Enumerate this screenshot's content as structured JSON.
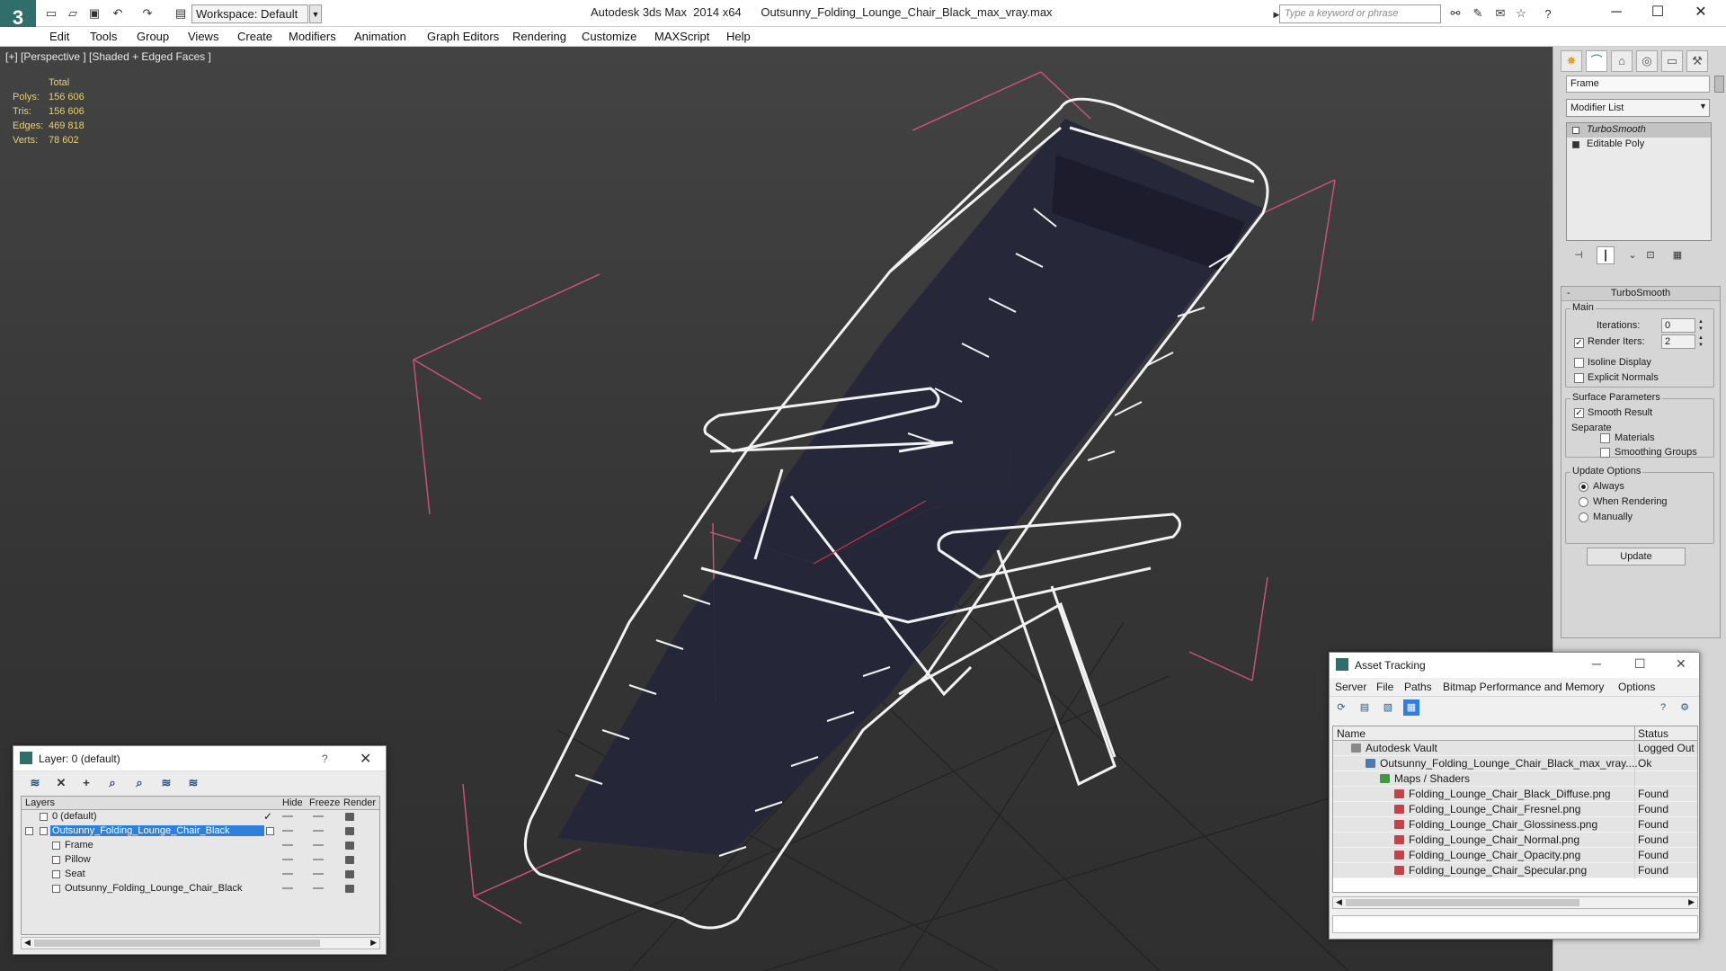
{
  "titlebar": {
    "workspace": "Workspace: Default",
    "title": "Autodesk 3ds Max  2014 x64      Outsunny_Folding_Lounge_Chair_Black_max_vray.max",
    "search_placeholder": "Type a keyword or phrase"
  },
  "menu": [
    "Edit",
    "Tools",
    "Group",
    "Views",
    "Create",
    "Modifiers",
    "Animation",
    "Graph Editors",
    "Rendering",
    "Customize",
    "MAXScript",
    "Help"
  ],
  "viewport": {
    "label": "[+] [Perspective ] [Shaded + Edged Faces ]",
    "stats": {
      "header": "Total",
      "rows": [
        {
          "k": "Polys:",
          "v": "156 606"
        },
        {
          "k": "Tris:",
          "v": "156 606"
        },
        {
          "k": "Edges:",
          "v": "469 818"
        },
        {
          "k": "Verts:",
          "v": "78 602"
        }
      ]
    }
  },
  "command_panel": {
    "object_name": "Frame",
    "modifier_list": "Modifier List",
    "stack": [
      "TurboSmooth",
      "Editable Poly"
    ],
    "rollout_title": "TurboSmooth",
    "main_title": "Main",
    "iterations_label": "Iterations:",
    "iterations_value": "0",
    "render_iters_label": "Render Iters:",
    "render_iters_value": "2",
    "isoline": "Isoline Display",
    "explicit_normals": "Explicit Normals",
    "surface_title": "Surface Parameters",
    "smooth_result": "Smooth Result",
    "separate": "Separate",
    "materials": "Materials",
    "smoothing_groups": "Smoothing Groups",
    "update_title": "Update Options",
    "always": "Always",
    "when_rendering": "When Rendering",
    "manually": "Manually",
    "update_button": "Update"
  },
  "layer_dialog": {
    "title": "Layer: 0 (default)",
    "help": "?",
    "columns": [
      "Layers",
      "Hide",
      "Freeze",
      "Render"
    ],
    "rows": [
      {
        "name": "0 (default)",
        "indent": 0
      },
      {
        "name": "Outsunny_Folding_Lounge_Chair_Black",
        "indent": 0
      },
      {
        "name": "Frame",
        "indent": 1
      },
      {
        "name": "Pillow",
        "indent": 1
      },
      {
        "name": "Seat",
        "indent": 1
      },
      {
        "name": "Outsunny_Folding_Lounge_Chair_Black",
        "indent": 1
      }
    ]
  },
  "asset_dialog": {
    "title": "Asset Tracking",
    "menu": [
      "Server",
      "File",
      "Paths",
      "Bitmap Performance and Memory",
      "Options"
    ],
    "columns": [
      "Name",
      "Status"
    ],
    "rows": [
      {
        "name": "Autodesk Vault",
        "status": "Logged Out",
        "indent": 1
      },
      {
        "name": "Outsunny_Folding_Lounge_Chair_Black_max_vray....",
        "status": "Ok",
        "indent": 2
      },
      {
        "name": "Maps / Shaders",
        "status": "",
        "indent": 3
      },
      {
        "name": "Folding_Lounge_Chair_Black_Diffuse.png",
        "status": "Found",
        "indent": 4
      },
      {
        "name": "Folding_Lounge_Chair_Fresnel.png",
        "status": "Found",
        "indent": 4
      },
      {
        "name": "Folding_Lounge_Chair_Glossiness.png",
        "status": "Found",
        "indent": 4
      },
      {
        "name": "Folding_Lounge_Chair_Normal.png",
        "status": "Found",
        "indent": 4
      },
      {
        "name": "Folding_Lounge_Chair_Opacity.png",
        "status": "Found",
        "indent": 4
      },
      {
        "name": "Folding_Lounge_Chair_Specular.png",
        "status": "Found",
        "indent": 4
      }
    ]
  },
  "colors": {
    "stats_text": "#e6d07a",
    "selection_blue": "#2f7fdd",
    "bbox_pink": "#d0537a",
    "wire_white": "#f2f2f2",
    "seat_navy": "#26263a"
  }
}
